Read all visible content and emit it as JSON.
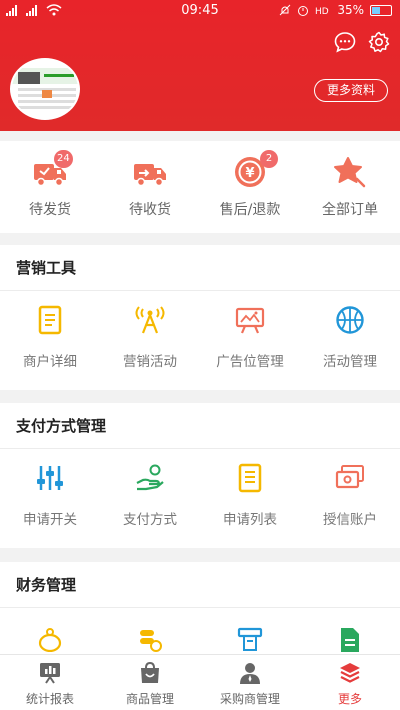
{
  "status_bar": {
    "time": "09:45",
    "battery": "35%"
  },
  "header": {
    "more_info_label": "更多资料",
    "icons": [
      "message-icon",
      "settings-icon"
    ]
  },
  "orders": [
    {
      "label": "待发货",
      "badge": "24",
      "icon": "truck-icon"
    },
    {
      "label": "待收货",
      "badge": "",
      "icon": "truck-icon"
    },
    {
      "label": "售后/退款",
      "badge": "2",
      "icon": "refund-icon"
    },
    {
      "label": "全部订单",
      "badge": "",
      "icon": "star-icon"
    }
  ],
  "marketing": {
    "title": "营销工具",
    "items": [
      {
        "label": "商户详细",
        "icon": "document-icon"
      },
      {
        "label": "营销活动",
        "icon": "broadcast-icon"
      },
      {
        "label": "广告位管理",
        "icon": "billboard-icon"
      },
      {
        "label": "活动管理",
        "icon": "basketball-icon"
      }
    ]
  },
  "payment": {
    "title": "支付方式管理",
    "items": [
      {
        "label": "申请开关",
        "icon": "sliders-icon"
      },
      {
        "label": "支付方式",
        "icon": "hand-coin-icon"
      },
      {
        "label": "申请列表",
        "icon": "list-icon"
      },
      {
        "label": "授信账户",
        "icon": "cash-icon"
      }
    ]
  },
  "finance": {
    "title": "财务管理",
    "items": [
      {
        "icon": "piggy-bank-icon"
      },
      {
        "icon": "coins-icon"
      },
      {
        "icon": "atm-icon"
      },
      {
        "icon": "report-icon"
      }
    ]
  },
  "tabbar": [
    {
      "label": "统计报表",
      "icon": "chart-board-icon",
      "active": false
    },
    {
      "label": "商品管理",
      "icon": "bag-icon",
      "active": false
    },
    {
      "label": "采购商管理",
      "icon": "user-icon",
      "active": false
    },
    {
      "label": "更多",
      "icon": "layers-icon",
      "active": true
    }
  ],
  "colors": {
    "brand_red": "#e8242a",
    "accent_yellow": "#f5b800",
    "accent_blue": "#2196d8",
    "accent_green": "#2aa85e",
    "accent_salmon": "#f0705a"
  }
}
